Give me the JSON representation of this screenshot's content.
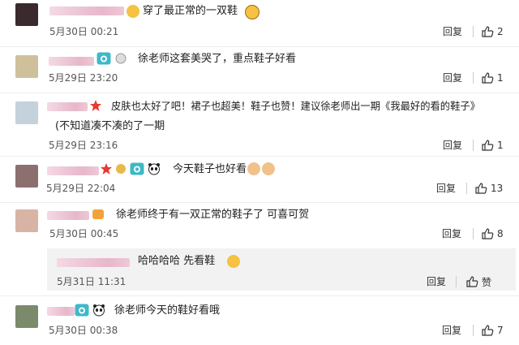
{
  "comments": [
    {
      "text": "穿了最正常的一双鞋",
      "time": "5月30日 00:21",
      "reply": "回复",
      "likes": "2"
    },
    {
      "text": "徐老师这套美哭了，重点鞋子好看",
      "time": "5月29日 23:20",
      "reply": "回复",
      "likes": "1"
    },
    {
      "text": "皮肤也太好了吧！裙子也超美！鞋子也赞！建议徐老师出一期《我最好的看的鞋子》",
      "text2": "(不知道凑不凑的了一期",
      "time": "5月29日 23:16",
      "reply": "回复",
      "likes": "1"
    },
    {
      "text": "今天鞋子也好看",
      "time": "5月29日 22:04",
      "reply": "回复",
      "likes": "13"
    },
    {
      "text": "徐老师终于有一双正常的鞋子了 可喜可贺",
      "time": "5月30日 00:45",
      "reply": "回复",
      "likes": "8"
    },
    {
      "text": "徐老师今天的鞋好看哦",
      "time": "5月30日 00:38",
      "reply": "回复",
      "likes": "7"
    }
  ],
  "sub_reply": {
    "text": "哈哈哈哈 先看鞋",
    "time": "5月31日 11:31",
    "reply": "回复",
    "likes": "赞"
  },
  "icons": {
    "like": "thumbs-up-icon",
    "camera": "camera-badge-icon",
    "star": "red-star-icon",
    "panda": "panda-icon"
  },
  "colors": {
    "name": "#e7b7ca",
    "divider": "#eeeeee",
    "subbox": "#f2f2f2"
  }
}
